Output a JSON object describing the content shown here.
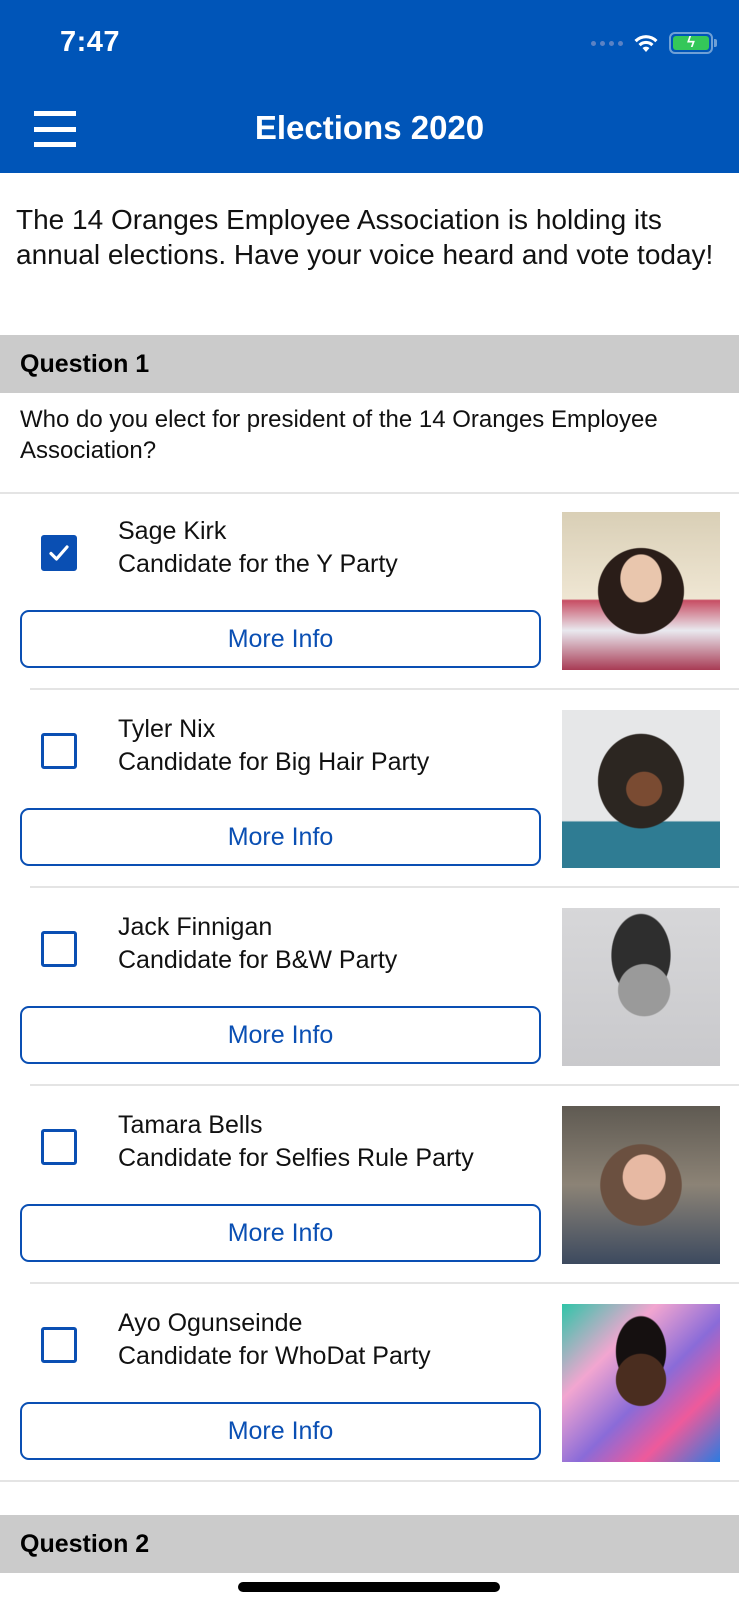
{
  "status_bar": {
    "time": "7:47",
    "icons": [
      "cellular-signal-icon",
      "wifi-icon",
      "battery-charging-icon"
    ]
  },
  "nav": {
    "menu_icon": "hamburger-menu-icon",
    "title": "Elections 2020"
  },
  "intro": "The 14 Oranges Employee Association is holding its annual elections. Have your voice heard and vote today!",
  "questions": [
    {
      "header": "Question 1",
      "text": "Who do you elect for president of the 14 Oranges Employee Association?",
      "candidates": [
        {
          "name": "Sage Kirk",
          "party": "Candidate for the Y Party",
          "checked": true,
          "button": "More Info"
        },
        {
          "name": "Tyler Nix",
          "party": "Candidate for Big Hair Party",
          "checked": false,
          "button": "More Info"
        },
        {
          "name": "Jack Finnigan",
          "party": "Candidate for B&W Party",
          "checked": false,
          "button": "More Info"
        },
        {
          "name": "Tamara Bells",
          "party": "Candidate for Selfies Rule Party",
          "checked": false,
          "button": "More Info"
        },
        {
          "name": "Ayo Ogunseinde",
          "party": "Candidate for WhoDat Party",
          "checked": false,
          "button": "More Info"
        }
      ]
    },
    {
      "header": "Question 2"
    }
  ],
  "colors": {
    "brand": "#0055b8",
    "accent": "#0a4fb3",
    "section_header_bg": "#cbcbcb"
  }
}
